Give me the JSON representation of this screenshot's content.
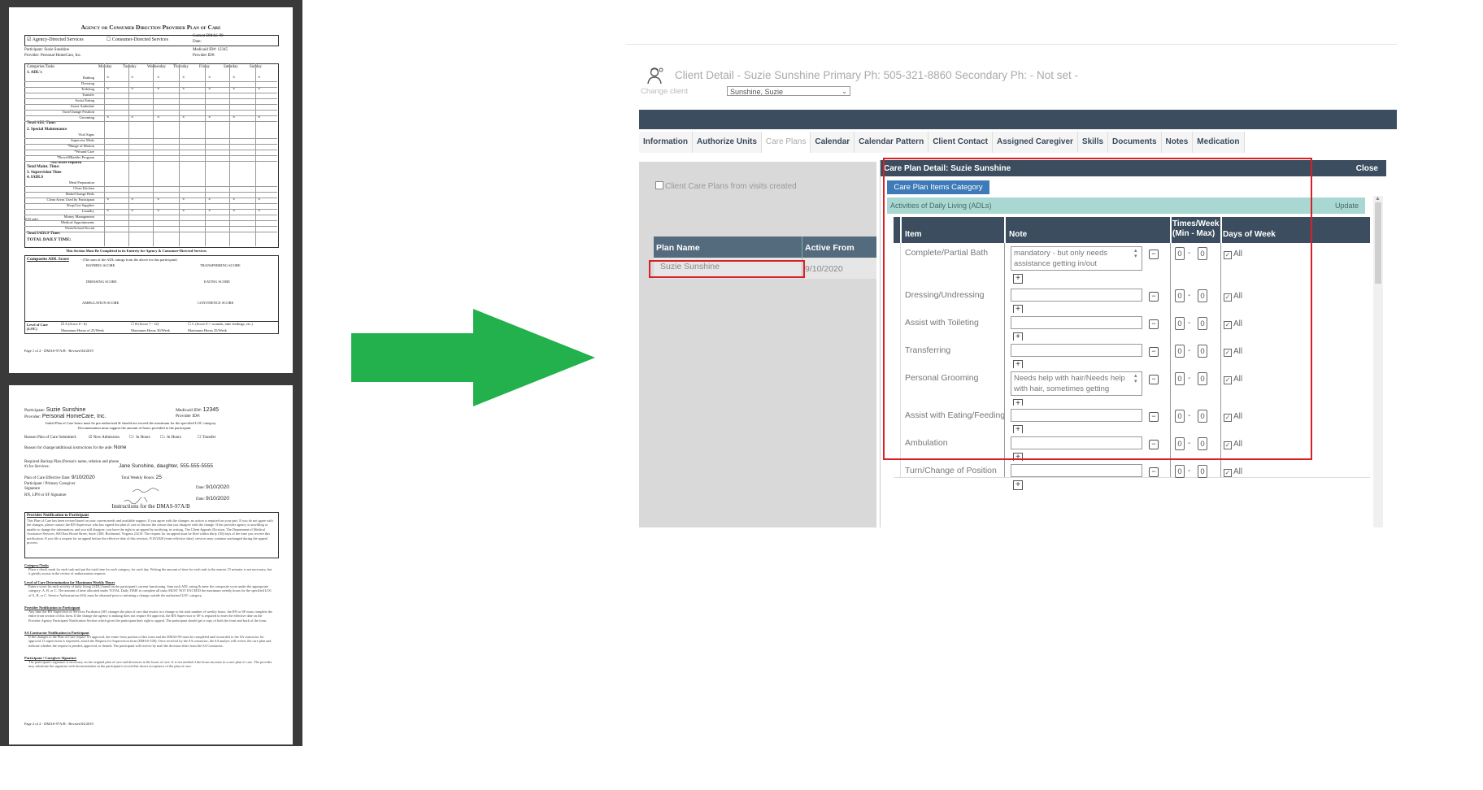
{
  "doc1": {
    "title": "Agency or Consumer Direction Provider Plan of Care",
    "agency_directed": "Agency-Directed Services",
    "consumer_directed": "Consumer-Directed Services",
    "current_dmas": "Current DMAS-99",
    "date_label": "Date:",
    "participant_label": "Participant:",
    "participant_value": "Suzie Sunshine",
    "provider_label": "Provider:",
    "provider_value": "Personal HomeCare, Inc.",
    "medicaid_label": "Medicaid ID#:",
    "medicaid_value": "12345",
    "provider_id_label": "Provider ID#:",
    "col_headers": [
      "Categories/Tasks",
      "Monday",
      "Tuesday",
      "Wednesday",
      "Thursday",
      "Friday",
      "Saturday",
      "Sunday"
    ],
    "section1": "1.     ADL's",
    "adl_rows": [
      "Bathing",
      "Dressing",
      "Toileting",
      "Transfer",
      "Assist Eating",
      "Assist Ambulate",
      "Turn/Change Position",
      "Grooming"
    ],
    "total_adl": "Total ADL Time:",
    "section2": "2.     Special Maintenance",
    "sm_rows": [
      "Vital Signs",
      "Supervise Meds",
      "*Range of Motion",
      "*Wound Care",
      "*Bowel/Bladder Program"
    ],
    "mb_order": "*MD order required",
    "total_maint": "Total Maint. Time:",
    "section3": "3.     Supervision Time",
    "section4": "4.     IADLS",
    "iadl_rows": [
      "Meal Preparation",
      "Clean Kitchen",
      "Make/Change Beds",
      "Clean Areas Used by Participant",
      "Shop/List Supplies",
      "Laundry",
      "Money Management",
      "Medical Appointments",
      "Work/School/Social"
    ],
    "cd_only": "(CD only)",
    "total_iadl": "Total IADLS Time:",
    "total_daily": "TOTAL DAILY TIME:",
    "section_note": "This Section Must Be Completed in its Entirety for Agency & Consumer-Directed Services",
    "composite": "Composite ADL Score",
    "composite_note": "- (The sum of the ADL ratings from the above for this participant)",
    "bathing_score": "BATHING SCORE",
    "transferring_score": "TRANSFERRING SCORE",
    "dressing_score": "DRESSING SCORE",
    "eating_score": "EATING SCORE",
    "ambulation_score": "AMBULATION SCORE",
    "continence_score": "CONTINENCE SCORE",
    "level_of_care": "Level of Care (LOC)",
    "loc_a": "A (Score 0 - 6)",
    "loc_b": "B (Score 7 - 12)",
    "loc_c": "C (Score 9 + wounds, tube feedings, etc.)",
    "max_a": "Maximum Hours of 25/Week",
    "max_b": "Maximum Hours 30/Week",
    "max_c": "Maximum Hours 35/Week",
    "footer": "Page 1 of 2 - DMAS-97A/B - Revised 04/2019"
  },
  "doc2": {
    "participant_label": "Participant:",
    "participant_value": "Suzie Sunshine",
    "medicaid_label": "Medicaid ID#:",
    "medicaid_value": "12345",
    "provider_label": "Provider:",
    "provider_value": "Personal HomeCare, Inc.",
    "provider_id_label": "Provider ID#:",
    "initial_note": "Initial Plan of Care hours must be pre-authorized & should not exceed the maximum for the specified LOC category.",
    "doc_note": "Documentation must support the amount of hours provided to the participant.",
    "reason_label": "Reason Plan of Care Submitted:",
    "new_admission": "New Admission",
    "increase": "In Hours",
    "decrease": "In Hours",
    "transfer": "Transfer",
    "reason_change": "Reason for change/additional instructions for the aide:",
    "reason_value": "None",
    "backup_label": "Required Backup Plan (Person's name, relation and phone #) for Services:",
    "backup_value": "Jane Sunshine, daughter, 555-555-5555",
    "effective_label": "Plan of Care Effective Date:",
    "effective_value": "9/10/2020",
    "weekly_label": "Total Weekly Hours:",
    "weekly_value": "25",
    "caregiver_label": "Participant / Primary Caregiver Signature",
    "rn_label": "RN, LPN or SF Signature",
    "date_label": "Date:",
    "date_value": "9/10/2020",
    "instructions_title": "Instructions for the DMAS-97A/B",
    "notification_title": "Provider Notification to Participant",
    "notification_text": "This Plan of Care has been revised based on your current needs and available support. If you agree with the changes, no action is required on your part. If you do not agree with the changes, please contact the RN Supervisor who has signed the plan of care to discuss the reason that you disagree with the change. If the provider agency is unwilling or unable to change the information, and you still disagree, you have the right to an appeal by notifying, in writing, The Client Appeals Division, The Department of Medical Assistance Services, 600 East Broad Street, Suite 1300, Richmond, Virginia 23219. The request for an appeal must be filed within thirty (30) days of the time you receive this notification. If you file a request for an appeal before the effective date of this revision, 9/10/2020 (enter effective date), services may continue unchanged during the appeal process.",
    "category_tasks_title": "Category/Tasks",
    "category_tasks_text": "Place a check mark for each task and put the total time for each category, for each day. Writing the amount of time for each task to the nearest 15 minutes is not necessary, but it greatly assists in the review of authorization requests.",
    "loc_title": "Level of Care Determination for Maximum Weekly Hours",
    "loc_text": "Enter a score for each activity of daily living (ADL) based on the participant's current functioning. Sum each ADL rating & enter the composite score under the appropriate category: A, B, or C. The amount of time allocated under TOTAL Daily TIME to complete all tasks MUST NOT EXCEED the maximum weekly hours for the specified LOC of A, B, or C. Service Authorization (SA) must be obtained prior to initiating a change outside the authorized LOC category.",
    "pn_title": "Provider Notification to Participant",
    "pn_text": "Any time the RN Supervisor or Services Facilitator (SF) changes the plan of care that results in a change to the total number of weekly hours, the RN or SF must complete the entire front section of this form. If the change the agency is making does not require SA approval, the RN Supervisor or SF is required to enter the effective date on the Provider Agency Participant Notification Section which gives the participant their right to appeal. The participant should get a copy of both the front and back of the form.",
    "sa_title": "SA Contractor Notification to Participant",
    "sa_text": "If the changes to the Plan of Care require SA approval, the entire front portion of this form and the DMAS-99 must be completed and forwarded to the SA contractor for approval. If supervision is requested, attach the Request for Supervision form (DMAS-100). Once received by the SA contractor, the SA analyst will review the care plan and indicate whether the request is pended, approved, or denied. The participant will receive by mail the decision letter from the SA Contractor.",
    "sig_title": "Participant / Caregiver Signature",
    "sig_text": "The participant's signature is necessary on the original plan of care and decreases in the hours of care. It is not needed if the hours increase in a new plan of care. The provider may substitute the signature with documentation in the participant's record that shows acceptance of the plan of care.",
    "footer": "Page 2 of 2 - DMAS-97A/B - Revised 04/2019"
  },
  "app": {
    "title": "Client Detail - Suzie Sunshine Primary Ph: 505-321-8860 Secondary Ph: - Not set -",
    "change_client_label": "Change client",
    "change_client_value": "Sunshine, Suzie",
    "tabs": [
      {
        "label": "Information",
        "active": false
      },
      {
        "label": "Authorize Units",
        "active": false
      },
      {
        "label": "Care Plans",
        "active": true
      },
      {
        "label": "Calendar",
        "active": false
      },
      {
        "label": "Calendar Pattern",
        "active": false
      },
      {
        "label": "Client Contact",
        "active": false
      },
      {
        "label": "Assigned Caregiver",
        "active": false
      },
      {
        "label": "Skills",
        "active": false
      },
      {
        "label": "Documents",
        "active": false
      },
      {
        "label": "Notes",
        "active": false
      },
      {
        "label": "Medication",
        "active": false
      }
    ],
    "checkbox_label": "Client Care Plans from visits created",
    "plan_table": {
      "col_name": "Plan Name",
      "col_active": "Active From",
      "rows": [
        {
          "name": "Suzie Sunshine",
          "active_from": "9/10/2020"
        }
      ]
    },
    "detail": {
      "title": "Care Plan Detail: Suzie Sunshine",
      "close": "Close",
      "category_button": "Care Plan Items Category",
      "section_name": "Activities of Daily Living (ADLs)",
      "update": "Update",
      "col_item": "Item",
      "col_note": "Note",
      "col_times": "Times/Week (Min - Max)",
      "col_days": "Days of Week",
      "dash": "-",
      "all_label": "All",
      "items": [
        {
          "name": "Complete/Partial Bath",
          "note": "mandatory - but only needs assistance getting in/out",
          "min": "0",
          "max": "0",
          "all": true
        },
        {
          "name": "Dressing/Undressing",
          "note": "",
          "min": "0",
          "max": "0",
          "all": true
        },
        {
          "name": "Assist with Toileting",
          "note": "",
          "min": "0",
          "max": "0",
          "all": true
        },
        {
          "name": "Transferring",
          "note": "",
          "min": "0",
          "max": "0",
          "all": true
        },
        {
          "name": "Personal Grooming",
          "note": "Needs help with hair/Needs help with hair, sometimes getting",
          "min": "0",
          "max": "0",
          "all": true
        },
        {
          "name": "Assist with Eating/Feeding",
          "note": "",
          "min": "0",
          "max": "0",
          "all": true
        },
        {
          "name": "Ambulation",
          "note": "",
          "min": "0",
          "max": "0",
          "all": true
        },
        {
          "name": "Turn/Change of Position",
          "note": "",
          "min": "0",
          "max": "0",
          "all": true
        }
      ]
    }
  },
  "colors": {
    "arrow": "#22b14c",
    "highlight": "#d92027",
    "dark_header": "#3b4d5e",
    "section_teal": "#a9d7d2",
    "button_blue": "#3e7ab8"
  }
}
